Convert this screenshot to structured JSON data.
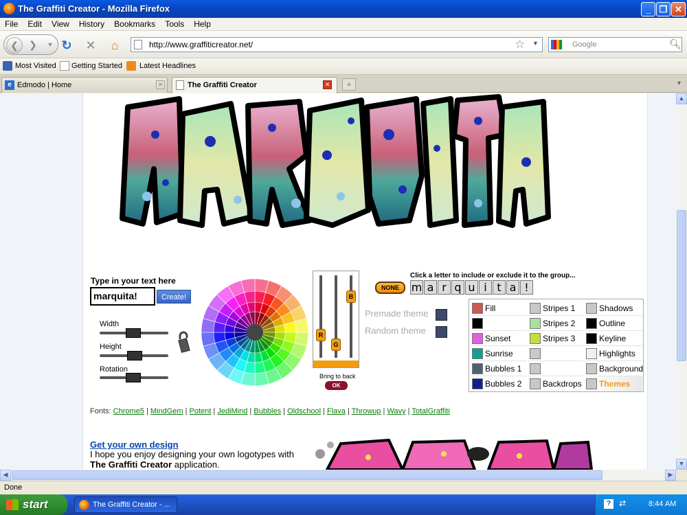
{
  "window": {
    "title": "The Graffiti Creator - Mozilla Firefox"
  },
  "menu": [
    "File",
    "Edit",
    "View",
    "History",
    "Bookmarks",
    "Tools",
    "Help"
  ],
  "nav": {
    "url": "http://www.graffiticreator.net/",
    "search_placeholder": "Google"
  },
  "bookmarks": [
    "Most Visited",
    "Getting Started",
    "Latest Headlines"
  ],
  "tabs": [
    {
      "label": "Edmodo | Home"
    },
    {
      "label": "The Graffiti Creator"
    }
  ],
  "page": {
    "type_label": "Type in your text here",
    "text_value": "marquita!",
    "create_label": "Create!",
    "sliders": [
      "Width",
      "Height",
      "Rotation"
    ],
    "bring_to_back": "Bring to back",
    "ok_label": "OK",
    "premade_theme": "Premade theme",
    "random_theme": "Random theme",
    "none_label": "NONE",
    "click_letter_hint": "Click a letter to include or exclude it to the group...",
    "letters": [
      "m",
      "a",
      "r",
      "q",
      "u",
      "i",
      "t",
      "a",
      "!"
    ],
    "rgb_knobs": [
      "R",
      "G",
      "B"
    ],
    "palette": [
      [
        {
          "label": "Fill",
          "color": "#c85a55"
        },
        {
          "label": "Stripes 1",
          "color": "#c8c8c8"
        },
        {
          "label": "Shadows",
          "color": "#c8c8c8"
        }
      ],
      [
        {
          "label": "",
          "color": "#000000"
        },
        {
          "label": "Stripes 2",
          "color": "#a8e0a0"
        },
        {
          "label": "Outline",
          "color": "#000000"
        }
      ],
      [
        {
          "label": "Sunset",
          "color": "#e060e0"
        },
        {
          "label": "Stripes 3",
          "color": "#c0e040"
        },
        {
          "label": "Keyline",
          "color": "#000000"
        }
      ],
      [
        {
          "label": "Sunrise",
          "color": "#10a090"
        },
        {
          "label": "",
          "color": "#c8c8c8"
        },
        {
          "label": "Highlights",
          "color": "#f0f0f0"
        }
      ],
      [
        {
          "label": "Bubbles 1",
          "color": "#506070"
        },
        {
          "label": "",
          "color": "#c8c8c8"
        },
        {
          "label": "Background",
          "color": "#c8c8c8"
        }
      ],
      [
        {
          "label": "Bubbles 2",
          "color": "#102090"
        },
        {
          "label": "Backdrops",
          "color": "#c8c8c8"
        },
        {
          "label": "Themes",
          "color": "#c8c8c8"
        }
      ]
    ],
    "fonts_label": "Fonts:",
    "fonts": [
      "Chrome5",
      "MindGem",
      "Potent",
      "JediMind",
      "Bubbles",
      "Oldschool",
      "Flava",
      "Throwup",
      "Wavy",
      "TotalGraffiti"
    ],
    "get_own": "Get your own design",
    "enjoy_prefix": "I hope you enjoy designing your own logotypes with ",
    "enjoy_bold": "The Graffiti Creator",
    "enjoy_suffix": " application."
  },
  "status": "Done",
  "taskbar": {
    "start": "start",
    "item": "The Graffiti Creator - ...",
    "clock": "8:44 AM"
  }
}
